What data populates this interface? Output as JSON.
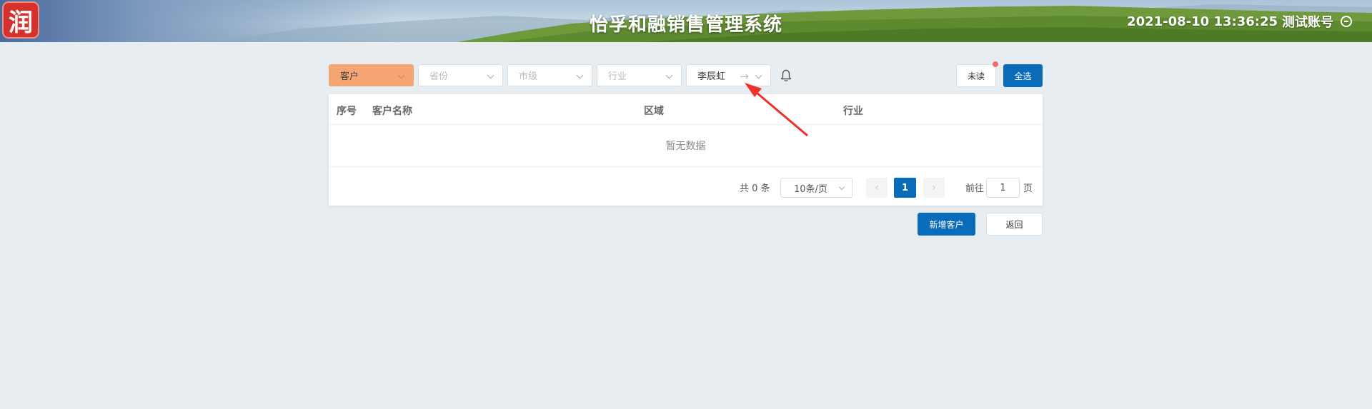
{
  "header": {
    "logo_char": "润",
    "title": "怡孚和融销售管理系统",
    "datetime": "2021-08-10 13:36:25",
    "account": "测试账号",
    "logout_icon": "logout-circle-icon"
  },
  "filters": {
    "customer": "客户",
    "province": "省份",
    "city": "市级",
    "industry": "行业",
    "user": "李辰虹"
  },
  "toolbar": {
    "unread_label": "未读",
    "select_all_label": "全选",
    "bell_icon": "bell-icon"
  },
  "table": {
    "columns": [
      "序号",
      "客户名称",
      "区域",
      "行业"
    ],
    "empty_text": "暂无数据"
  },
  "pagination": {
    "total_text": "共 0 条",
    "page_size": "10条/页",
    "current_page": "1",
    "goto_label": "前往",
    "goto_value": "1",
    "goto_suffix": "页"
  },
  "actions": {
    "add_customer_label": "新增客户",
    "back_label": "返回"
  },
  "colors": {
    "primary": "#0a6bb8",
    "active_filter": "#f5a474",
    "annotation_arrow": "#f0302a",
    "badge_dot": "#f56c6c"
  }
}
